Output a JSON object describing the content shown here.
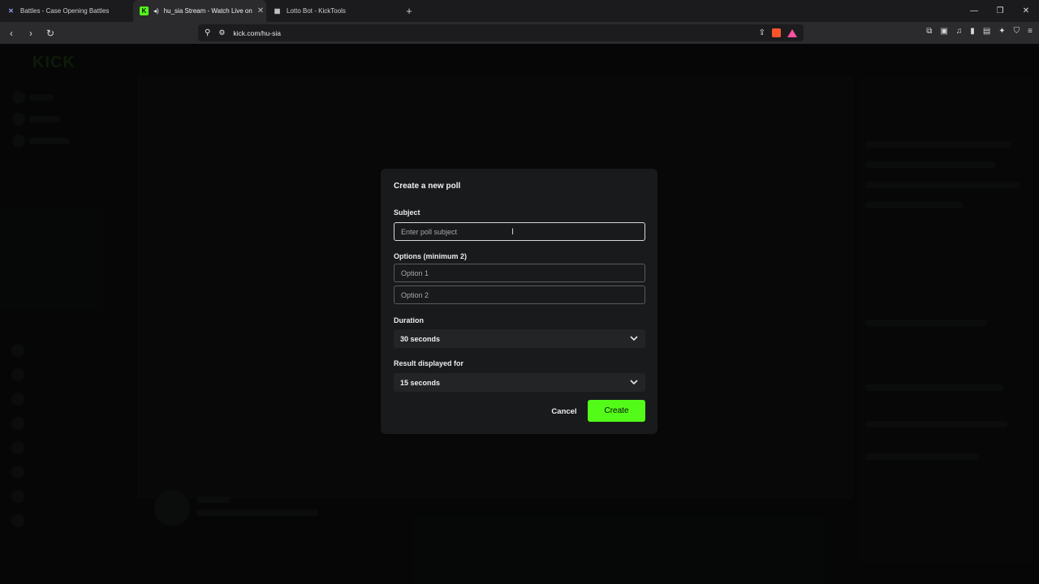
{
  "browser": {
    "tabs": [
      {
        "title": "Battles - Case Opening Battles",
        "icon": "battles-favicon-icon",
        "active": false
      },
      {
        "title": "hu_sia Stream - Watch Live on",
        "icon": "kick-favicon-icon",
        "active": true
      },
      {
        "title": "Lotto Bot - KickTools",
        "icon": "grid-favicon-icon",
        "active": false
      }
    ],
    "url": "kick.com/hu-sia"
  },
  "modal": {
    "title": "Create a new poll",
    "subject_label": "Subject",
    "subject_placeholder": "Enter poll subject",
    "subject_value": "",
    "options_label": "Options (minimum 2)",
    "option1_placeholder": "Option 1",
    "option2_placeholder": "Option 2",
    "duration_label": "Duration",
    "duration_value": "30 seconds",
    "result_label": "Result displayed for",
    "result_value": "15 seconds",
    "cancel_label": "Cancel",
    "create_label": "Create"
  },
  "colors": {
    "accent": "#53fc18",
    "modal_bg": "#191a1b",
    "page_bg": "#0e0f10"
  }
}
